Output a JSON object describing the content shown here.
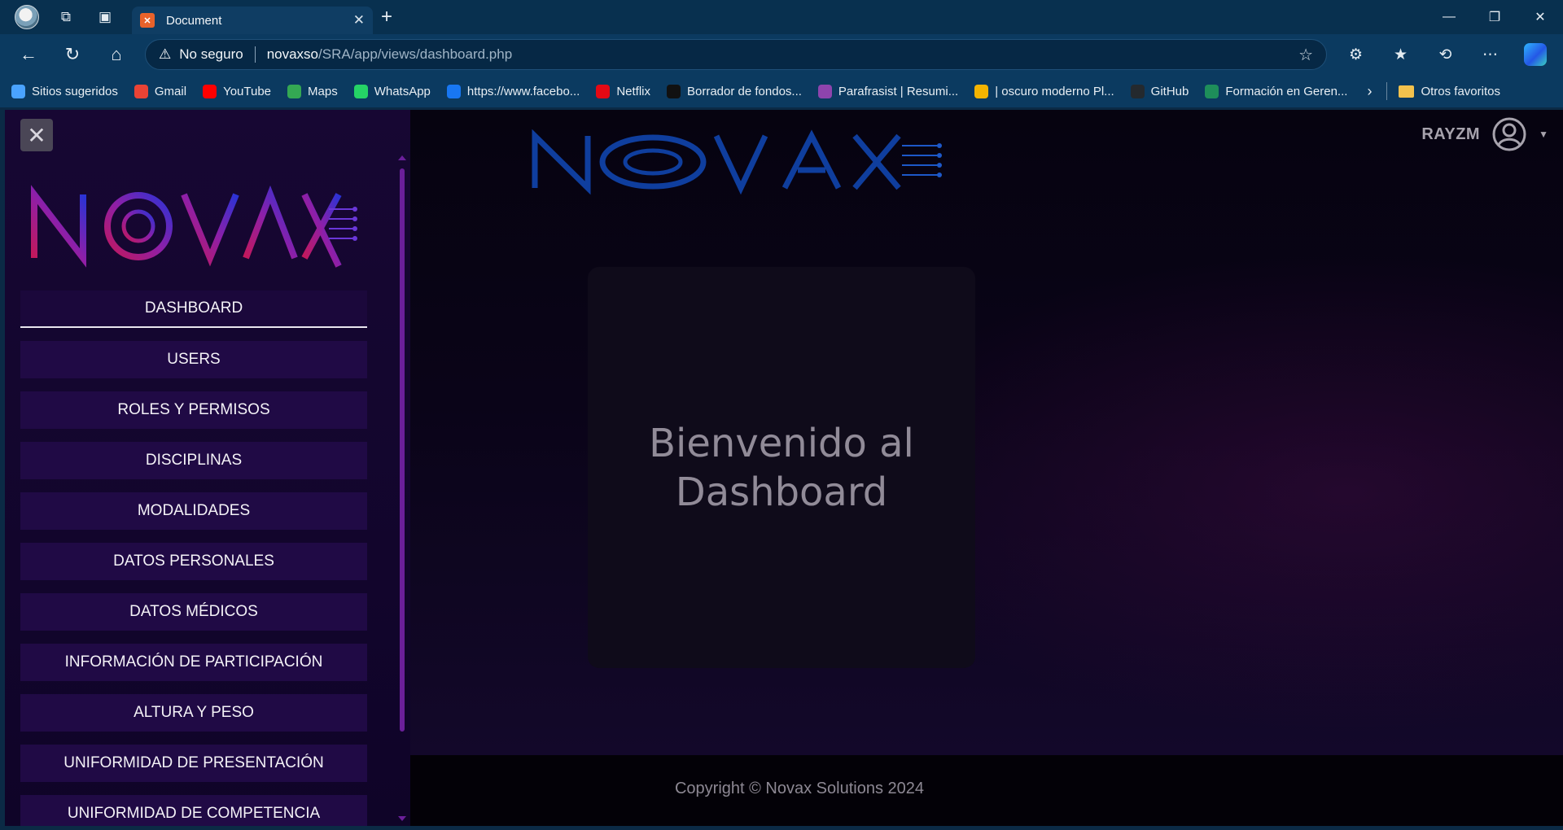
{
  "browser": {
    "tab_title": "Document",
    "address": {
      "security": "No seguro",
      "host": "novaxso",
      "path": "/SRA/app/views/dashboard.php"
    },
    "bookmarks": [
      {
        "label": "Sitios sugeridos",
        "icon": "search-icon",
        "color": "#4aa3ff"
      },
      {
        "label": "Gmail",
        "icon": "gmail-icon",
        "color": "#ea4335"
      },
      {
        "label": "YouTube",
        "icon": "youtube-icon",
        "color": "#ff0000"
      },
      {
        "label": "Maps",
        "icon": "maps-icon",
        "color": "#34a853"
      },
      {
        "label": "WhatsApp",
        "icon": "whatsapp-icon",
        "color": "#25d366"
      },
      {
        "label": "https://www.facebo...",
        "icon": "facebook-icon",
        "color": "#1877f2"
      },
      {
        "label": "Netflix",
        "icon": "netflix-icon",
        "color": "#e50914"
      },
      {
        "label": "Borrador de fondos...",
        "icon": "tiktok-icon",
        "color": "#111111"
      },
      {
        "label": "Parafrasist | Resumi...",
        "icon": "parafrasist-icon",
        "color": "#8e44ad"
      },
      {
        "label": "| oscuro moderno Pl...",
        "icon": "slides-icon",
        "color": "#f4b400"
      },
      {
        "label": "GitHub",
        "icon": "github-icon",
        "color": "#24292e"
      },
      {
        "label": "Formación en Geren...",
        "icon": "course-icon",
        "color": "#1e8e5a"
      }
    ],
    "other_favorites": "Otros favoritos"
  },
  "header": {
    "username": "RAYZM"
  },
  "sidebar": {
    "items": [
      {
        "label": "DASHBOARD",
        "active": true
      },
      {
        "label": "USERS"
      },
      {
        "label": "ROLES Y PERMISOS"
      },
      {
        "label": "DISCIPLINAS"
      },
      {
        "label": "MODALIDADES"
      },
      {
        "label": "DATOS PERSONALES"
      },
      {
        "label": "DATOS MÉDICOS"
      },
      {
        "label": "INFORMACIÓN DE PARTICIPACIÓN"
      },
      {
        "label": "ALTURA Y PESO"
      },
      {
        "label": "UNIFORMIDAD DE PRESENTACIÓN"
      },
      {
        "label": "UNIFORMIDAD DE COMPETENCIA"
      }
    ]
  },
  "main": {
    "welcome": "Bienvenido al Dashboard"
  },
  "footer": {
    "copyright": "Copyright © Novax Solutions 2024"
  },
  "colors": {
    "accent_purple": "#6b1f9a",
    "logo_blue": "#1546b8",
    "logo_pink": "#c2185b"
  }
}
